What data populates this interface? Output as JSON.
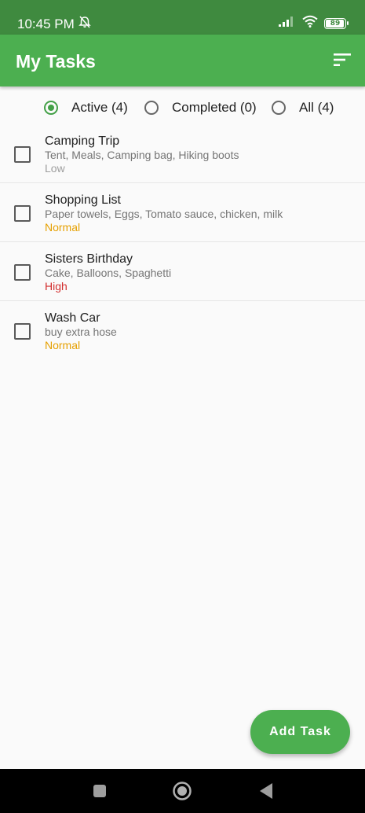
{
  "status_bar": {
    "time": "10:45 PM",
    "battery_level": "89",
    "icons": [
      "alarm-off-icon",
      "signal-icon",
      "wifi-icon",
      "battery-icon"
    ]
  },
  "app_bar": {
    "title": "My Tasks",
    "sort_icon": "sort-icon"
  },
  "filters": [
    {
      "label": "Active (4)",
      "selected": true
    },
    {
      "label": "Completed (0)",
      "selected": false
    },
    {
      "label": "All (4)",
      "selected": false
    }
  ],
  "tasks": [
    {
      "title": "Camping Trip",
      "description": "Tent, Meals, Camping bag, Hiking boots",
      "priority": "Low",
      "checked": false
    },
    {
      "title": "Shopping List",
      "description": "Paper towels, Eggs, Tomato sauce, chicken, milk",
      "priority": "Normal",
      "checked": false
    },
    {
      "title": "Sisters Birthday",
      "description": "Cake, Balloons, Spaghetti",
      "priority": "High",
      "checked": false
    },
    {
      "title": "Wash Car",
      "description": "buy extra hose",
      "priority": "Normal",
      "checked": false
    }
  ],
  "priority_colors": {
    "Low": "#9e9e9e",
    "Normal": "#e6a000",
    "High": "#d32f2f"
  },
  "fab": {
    "label": "Add Task"
  },
  "nav_bar": {
    "icons": [
      "recent-apps-icon",
      "home-icon",
      "back-icon"
    ]
  },
  "colors": {
    "status_bar": "#3f8a3f",
    "app_bar": "#4caf50",
    "accent": "#43a047"
  }
}
